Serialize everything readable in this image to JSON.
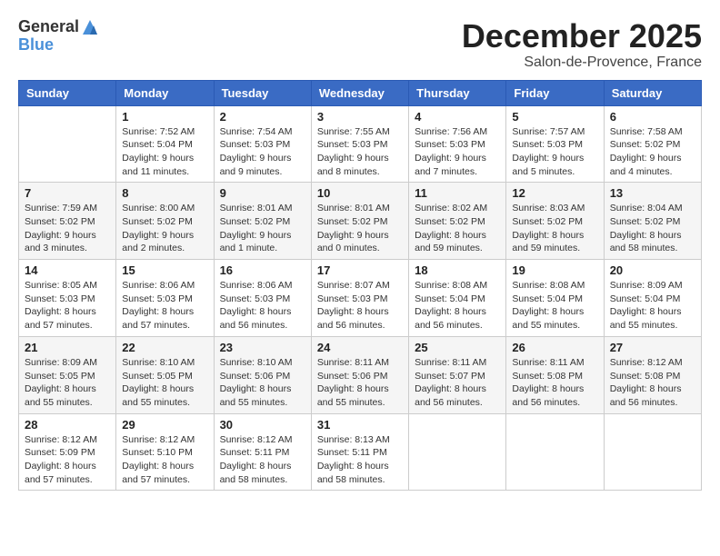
{
  "header": {
    "logo_general": "General",
    "logo_blue": "Blue",
    "month_title": "December 2025",
    "subtitle": "Salon-de-Provence, France"
  },
  "days_of_week": [
    "Sunday",
    "Monday",
    "Tuesday",
    "Wednesday",
    "Thursday",
    "Friday",
    "Saturday"
  ],
  "weeks": [
    [
      {
        "day": "",
        "info": ""
      },
      {
        "day": "1",
        "info": "Sunrise: 7:52 AM\nSunset: 5:04 PM\nDaylight: 9 hours\nand 11 minutes."
      },
      {
        "day": "2",
        "info": "Sunrise: 7:54 AM\nSunset: 5:03 PM\nDaylight: 9 hours\nand 9 minutes."
      },
      {
        "day": "3",
        "info": "Sunrise: 7:55 AM\nSunset: 5:03 PM\nDaylight: 9 hours\nand 8 minutes."
      },
      {
        "day": "4",
        "info": "Sunrise: 7:56 AM\nSunset: 5:03 PM\nDaylight: 9 hours\nand 7 minutes."
      },
      {
        "day": "5",
        "info": "Sunrise: 7:57 AM\nSunset: 5:03 PM\nDaylight: 9 hours\nand 5 minutes."
      },
      {
        "day": "6",
        "info": "Sunrise: 7:58 AM\nSunset: 5:02 PM\nDaylight: 9 hours\nand 4 minutes."
      }
    ],
    [
      {
        "day": "7",
        "info": "Sunrise: 7:59 AM\nSunset: 5:02 PM\nDaylight: 9 hours\nand 3 minutes."
      },
      {
        "day": "8",
        "info": "Sunrise: 8:00 AM\nSunset: 5:02 PM\nDaylight: 9 hours\nand 2 minutes."
      },
      {
        "day": "9",
        "info": "Sunrise: 8:01 AM\nSunset: 5:02 PM\nDaylight: 9 hours\nand 1 minute."
      },
      {
        "day": "10",
        "info": "Sunrise: 8:01 AM\nSunset: 5:02 PM\nDaylight: 9 hours\nand 0 minutes."
      },
      {
        "day": "11",
        "info": "Sunrise: 8:02 AM\nSunset: 5:02 PM\nDaylight: 8 hours\nand 59 minutes."
      },
      {
        "day": "12",
        "info": "Sunrise: 8:03 AM\nSunset: 5:02 PM\nDaylight: 8 hours\nand 59 minutes."
      },
      {
        "day": "13",
        "info": "Sunrise: 8:04 AM\nSunset: 5:02 PM\nDaylight: 8 hours\nand 58 minutes."
      }
    ],
    [
      {
        "day": "14",
        "info": "Sunrise: 8:05 AM\nSunset: 5:03 PM\nDaylight: 8 hours\nand 57 minutes."
      },
      {
        "day": "15",
        "info": "Sunrise: 8:06 AM\nSunset: 5:03 PM\nDaylight: 8 hours\nand 57 minutes."
      },
      {
        "day": "16",
        "info": "Sunrise: 8:06 AM\nSunset: 5:03 PM\nDaylight: 8 hours\nand 56 minutes."
      },
      {
        "day": "17",
        "info": "Sunrise: 8:07 AM\nSunset: 5:03 PM\nDaylight: 8 hours\nand 56 minutes."
      },
      {
        "day": "18",
        "info": "Sunrise: 8:08 AM\nSunset: 5:04 PM\nDaylight: 8 hours\nand 56 minutes."
      },
      {
        "day": "19",
        "info": "Sunrise: 8:08 AM\nSunset: 5:04 PM\nDaylight: 8 hours\nand 55 minutes."
      },
      {
        "day": "20",
        "info": "Sunrise: 8:09 AM\nSunset: 5:04 PM\nDaylight: 8 hours\nand 55 minutes."
      }
    ],
    [
      {
        "day": "21",
        "info": "Sunrise: 8:09 AM\nSunset: 5:05 PM\nDaylight: 8 hours\nand 55 minutes."
      },
      {
        "day": "22",
        "info": "Sunrise: 8:10 AM\nSunset: 5:05 PM\nDaylight: 8 hours\nand 55 minutes."
      },
      {
        "day": "23",
        "info": "Sunrise: 8:10 AM\nSunset: 5:06 PM\nDaylight: 8 hours\nand 55 minutes."
      },
      {
        "day": "24",
        "info": "Sunrise: 8:11 AM\nSunset: 5:06 PM\nDaylight: 8 hours\nand 55 minutes."
      },
      {
        "day": "25",
        "info": "Sunrise: 8:11 AM\nSunset: 5:07 PM\nDaylight: 8 hours\nand 56 minutes."
      },
      {
        "day": "26",
        "info": "Sunrise: 8:11 AM\nSunset: 5:08 PM\nDaylight: 8 hours\nand 56 minutes."
      },
      {
        "day": "27",
        "info": "Sunrise: 8:12 AM\nSunset: 5:08 PM\nDaylight: 8 hours\nand 56 minutes."
      }
    ],
    [
      {
        "day": "28",
        "info": "Sunrise: 8:12 AM\nSunset: 5:09 PM\nDaylight: 8 hours\nand 57 minutes."
      },
      {
        "day": "29",
        "info": "Sunrise: 8:12 AM\nSunset: 5:10 PM\nDaylight: 8 hours\nand 57 minutes."
      },
      {
        "day": "30",
        "info": "Sunrise: 8:12 AM\nSunset: 5:11 PM\nDaylight: 8 hours\nand 58 minutes."
      },
      {
        "day": "31",
        "info": "Sunrise: 8:13 AM\nSunset: 5:11 PM\nDaylight: 8 hours\nand 58 minutes."
      },
      {
        "day": "",
        "info": ""
      },
      {
        "day": "",
        "info": ""
      },
      {
        "day": "",
        "info": ""
      }
    ]
  ]
}
